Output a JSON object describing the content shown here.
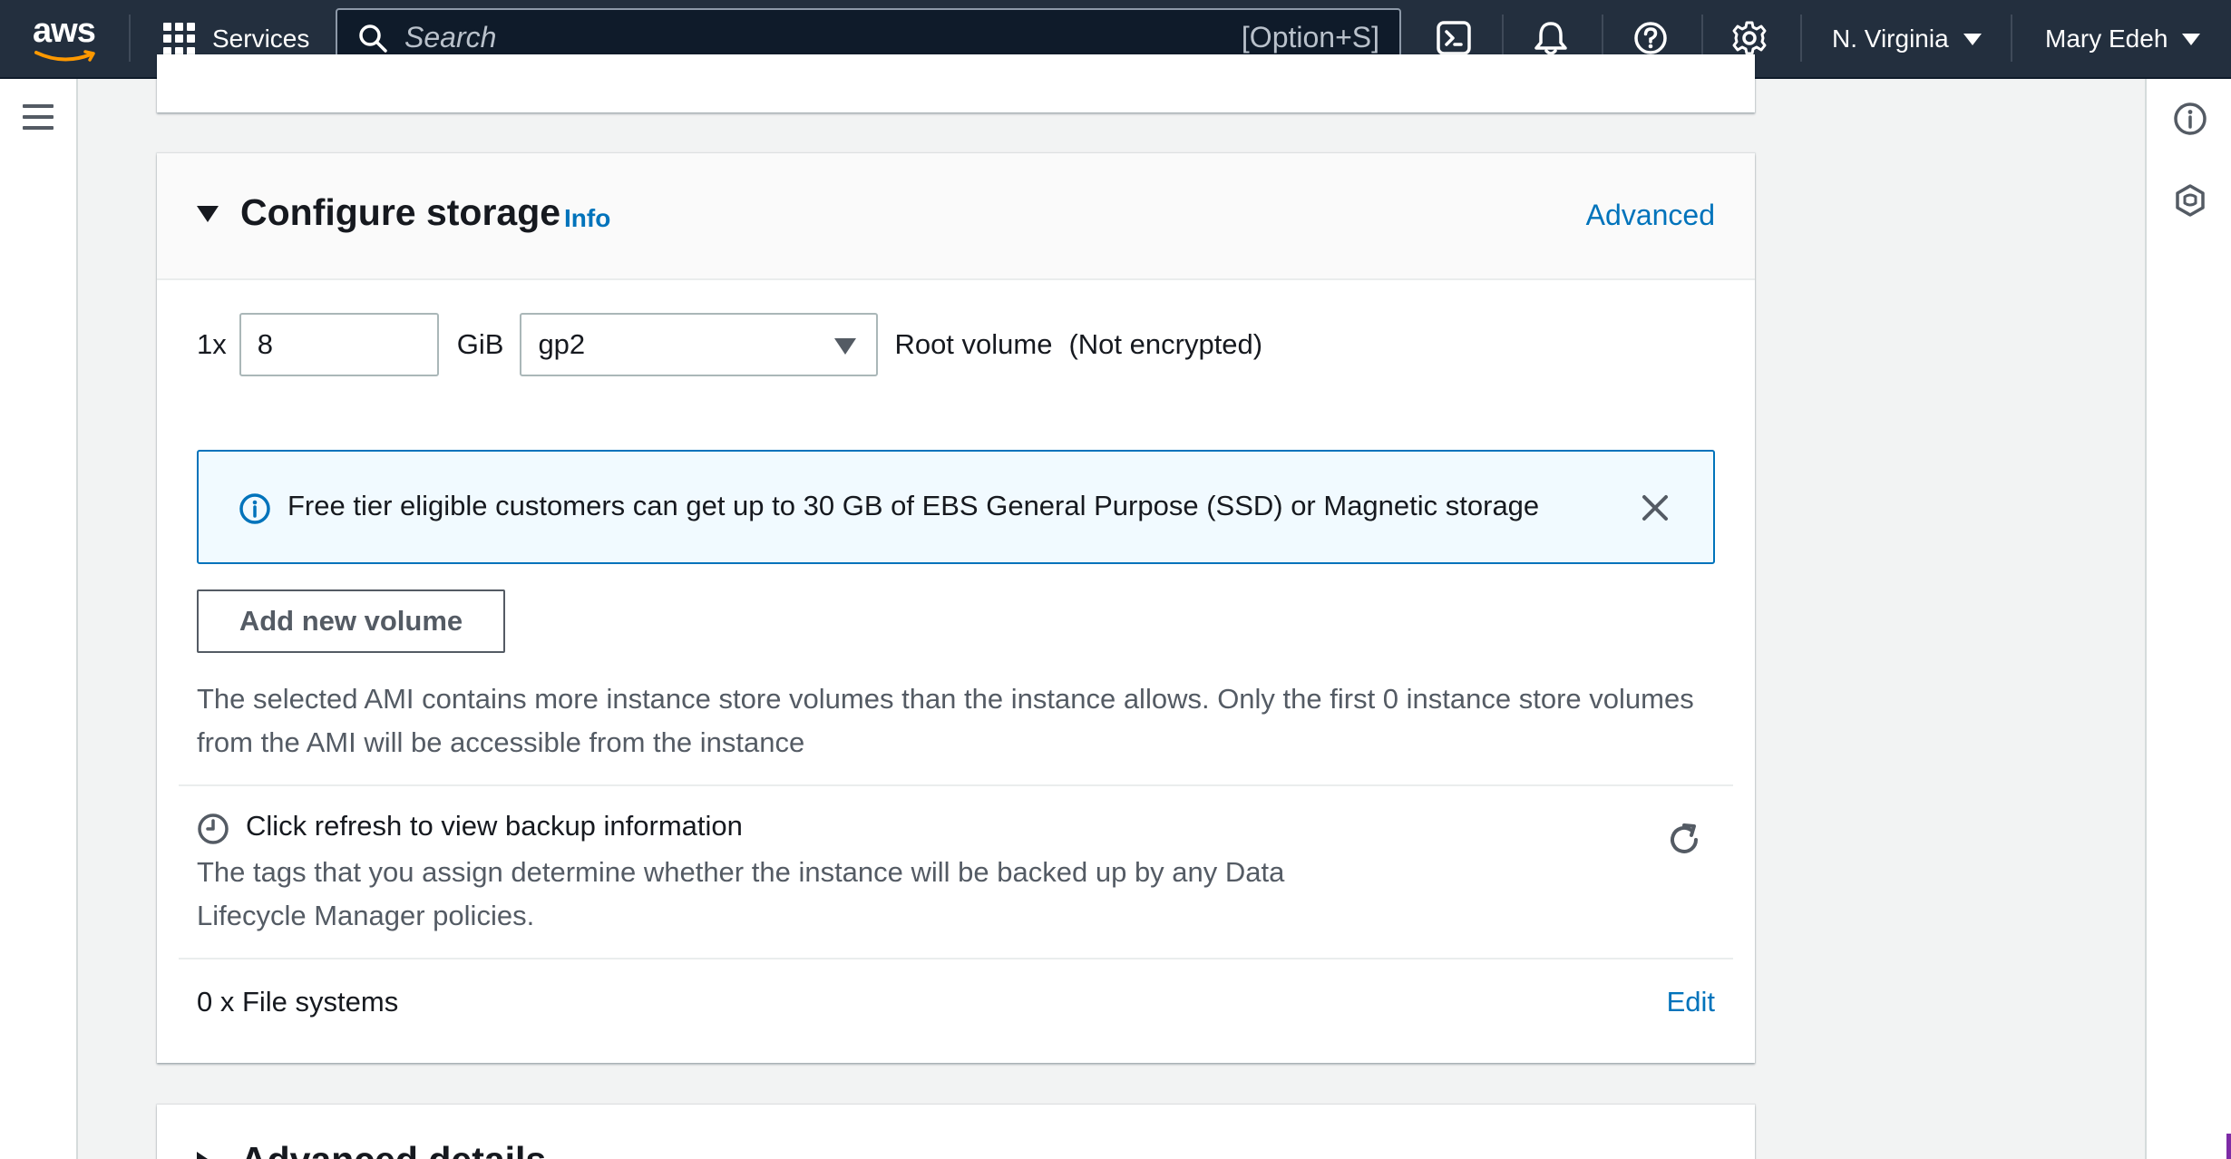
{
  "topnav": {
    "logo_text": "aws",
    "services_label": "Services",
    "search_placeholder": "Search",
    "search_shortcut": "[Option+S]",
    "region_label": "N. Virginia",
    "user_label": "Mary Edeh"
  },
  "storage": {
    "title": "Configure storage",
    "info_label": "Info",
    "advanced_label": "Advanced",
    "volume": {
      "count_label": "1x",
      "size_value": "8",
      "unit_label": "GiB",
      "type_value": "gp2",
      "root_label": "Root volume",
      "encryption_label": "(Not encrypted)"
    },
    "alert_text": "Free tier eligible customers can get up to 30 GB of EBS General Purpose (SSD) or Magnetic storage",
    "add_volume_label": "Add new volume",
    "ami_note": "The selected AMI contains more instance store volumes than the instance allows. Only the first 0 instance store volumes from the AMI will be accessible from the instance",
    "backup_title": "Click refresh to view backup information",
    "backup_desc": "The tags that you assign determine whether the instance will be backed up by any Data Lifecycle Manager policies.",
    "file_systems_label": "0 x File systems",
    "edit_label": "Edit"
  },
  "next_section": {
    "title": "Advanced details"
  },
  "colors": {
    "nav_bg": "#232f3e",
    "link": "#0073bb",
    "alert_bg": "#f1faff",
    "aws_orange": "#ff9900"
  }
}
